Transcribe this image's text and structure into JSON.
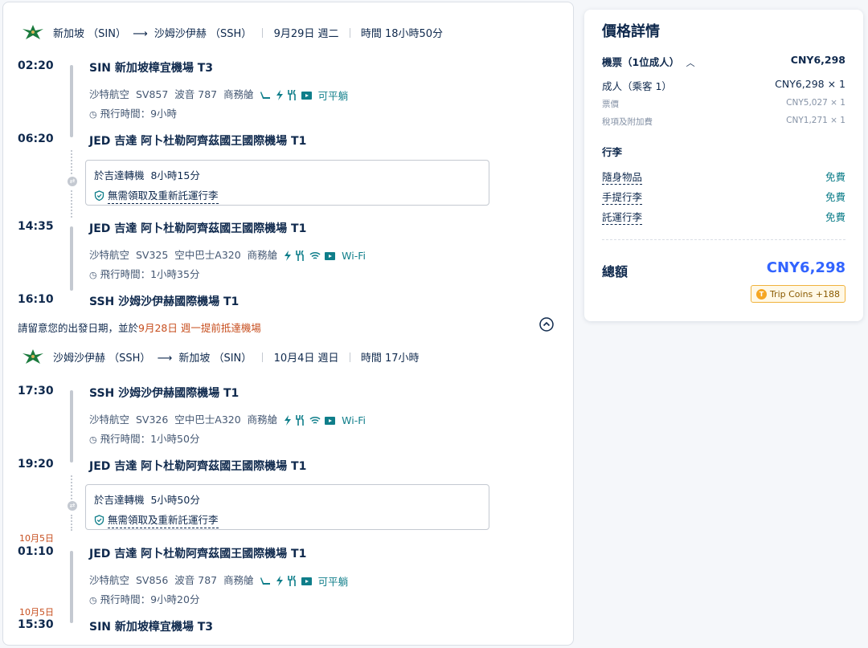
{
  "outbound": {
    "header": {
      "from": "新加坡 （SIN）",
      "to": "沙姆沙伊赫 （SSH）",
      "date": "9月29日 週二",
      "duration": "時間 18小時50分"
    },
    "seg1": {
      "dep_time": "02:20",
      "dep_airport": "SIN 新加坡樟宜機場 T3",
      "airline": "沙特航空",
      "flight": "SV857",
      "aircraft": "波音 787",
      "cabin": "商務艙",
      "amenity_text": "可平躺",
      "duration": "飛行時間：9小時",
      "arr_time": "06:20",
      "arr_airport": "JED 吉達 阿卜杜勒阿齊茲國王國際機場 T1"
    },
    "transfer": {
      "text": "於吉達轉機",
      "time": "8小時15分",
      "baggage": "無需領取及重新託運行李"
    },
    "seg2": {
      "dep_time": "14:35",
      "dep_airport": "JED 吉達 阿卜杜勒阿齊茲國王國際機場 T1",
      "airline": "沙特航空",
      "flight": "SV325",
      "aircraft": "空中巴士A320",
      "cabin": "商務艙",
      "amenity_text": "Wi-Fi",
      "duration": "飛行時間：1小時35分",
      "arr_time": "16:10",
      "arr_airport": "SSH 沙姆沙伊赫國際機場 T1"
    }
  },
  "notice": {
    "pre": "請留意您的出發日期，並於",
    "highlight": "9月28日 週一提前抵達機場"
  },
  "return": {
    "header": {
      "from": "沙姆沙伊赫 （SSH）",
      "to": "新加坡 （SIN）",
      "date": "10月4日 週日",
      "duration": "時間 17小時"
    },
    "seg1": {
      "dep_time": "17:30",
      "dep_airport": "SSH 沙姆沙伊赫國際機場 T1",
      "airline": "沙特航空",
      "flight": "SV326",
      "aircraft": "空中巴士A320",
      "cabin": "商務艙",
      "amenity_text": "Wi-Fi",
      "duration": "飛行時間：1小時50分",
      "arr_time": "19:20",
      "arr_airport": "JED 吉達 阿卜杜勒阿齊茲國王國際機場 T1"
    },
    "transfer": {
      "text": "於吉達轉機",
      "time": "5小時50分",
      "baggage": "無需領取及重新託運行李"
    },
    "seg2": {
      "dep_date": "10月5日",
      "dep_time": "01:10",
      "dep_airport": "JED 吉達 阿卜杜勒阿齊茲國王國際機場 T1",
      "airline": "沙特航空",
      "flight": "SV856",
      "aircraft": "波音 787",
      "cabin": "商務艙",
      "amenity_text": "可平躺",
      "duration": "飛行時間：9小時20分",
      "arr_date": "10月5日",
      "arr_time": "15:30",
      "arr_airport": "SIN 新加坡樟宜機場 T3"
    }
  },
  "price": {
    "title": "價格詳情",
    "ticket_label": "機票（1位成人）",
    "ticket_total": "CNY6,298",
    "adult_label": "成人（乘客 1）",
    "adult_value": "CNY6,298 × 1",
    "fare_label": "票價",
    "fare_value": "CNY5,027 × 1",
    "tax_label": "稅項及附加費",
    "tax_value": "CNY1,271 × 1",
    "baggage_title": "行李",
    "baggage": [
      {
        "label": "隨身物品",
        "value": "免費"
      },
      {
        "label": "手提行李",
        "value": "免費"
      },
      {
        "label": "託運行李",
        "value": "免費"
      }
    ],
    "total_label": "總額",
    "total_value": "CNY6,298",
    "coins": "Trip Coins +188"
  },
  "colors": {
    "accent_blue": "#3264ff",
    "teal": "#0f7e8a",
    "orange": "#c74e1e"
  }
}
